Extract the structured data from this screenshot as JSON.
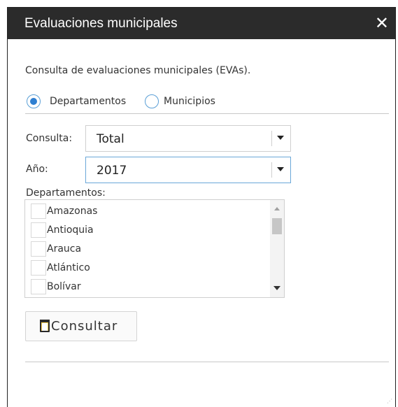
{
  "dialog": {
    "title": "Evaluaciones municipales",
    "close_symbol": "✕"
  },
  "description": "Consulta de evaluaciones municipales (EVAs).",
  "scope": {
    "options": [
      {
        "label": "Departamentos",
        "selected": true
      },
      {
        "label": "Municipios",
        "selected": false
      }
    ]
  },
  "consulta": {
    "label": "Consulta:",
    "value": "Total"
  },
  "anio": {
    "label": "Año:",
    "value": "2017"
  },
  "departamentos": {
    "label": "Departamentos:",
    "items": [
      "Amazonas",
      "Antioquia",
      "Arauca",
      "Atlántico",
      "Bolívar"
    ]
  },
  "actions": {
    "consultar_label": "Consultar"
  },
  "icons": {
    "close": "close-icon",
    "consultar": "clipboard-icon"
  },
  "colors": {
    "titlebar_bg": "#2b2b2b",
    "radio_selected": "#2e7fd1",
    "focus_border": "#6aa7d8"
  }
}
